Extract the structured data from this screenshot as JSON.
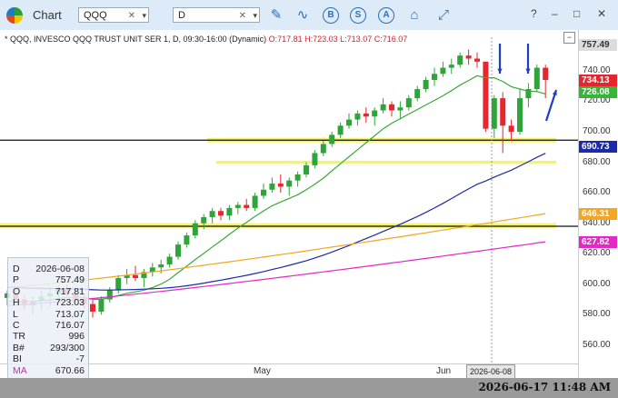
{
  "app": {
    "title": "Chart"
  },
  "toolbar": {
    "symbol": "QQQ",
    "interval": "D",
    "tools": [
      {
        "icon": "pencil-icon"
      },
      {
        "icon": "curve-tool-icon"
      },
      {
        "icon": "B",
        "type": "circle"
      },
      {
        "icon": "S",
        "type": "circle"
      },
      {
        "icon": "A",
        "type": "circle"
      },
      {
        "icon": "tag-icon"
      },
      {
        "icon": "expand-icon"
      }
    ]
  },
  "window_controls": {
    "help": "?",
    "minimize": "‒",
    "maximize": "□",
    "close": "✕"
  },
  "chart": {
    "header": "* QQQ, INVESCO QQQ TRUST UNIT SER 1, D, 09:30-16:00 (Dynamic)",
    "ohlc": "O:717.81 H:723.03 L:713.07 C:716.07",
    "price_ticks": [
      "740.00",
      "720.00",
      "700.00",
      "680.00",
      "660.00",
      "640.00",
      "620.00",
      "600.00",
      "580.00",
      "560.00"
    ],
    "price_tags": [
      {
        "label": "757.49",
        "value": 757.49,
        "bg": "#dcdcdc",
        "fg": "#333"
      },
      {
        "label": "734.13",
        "value": 734.13,
        "bg": "#e5262e",
        "fg": "#fff"
      },
      {
        "label": "726.08",
        "value": 726.08,
        "bg": "#38b43a",
        "fg": "#fff"
      },
      {
        "label": "690.73",
        "value": 690.73,
        "bg": "#1c2aa7",
        "fg": "#fff"
      },
      {
        "label": "646.31",
        "value": 646.31,
        "bg": "#f2a622",
        "fg": "#fff"
      },
      {
        "label": "627.82",
        "value": 627.82,
        "bg": "#e229c5",
        "fg": "#fff"
      }
    ],
    "date_labels": [
      "May",
      "Jun"
    ],
    "crosshair_date": "2026-06-08",
    "colors": {
      "up": "#2fa43a",
      "down": "#e8262e",
      "sma_short": "#3aa83a",
      "sma_mid": "#1c2aa7",
      "sma_long": "#f2a622",
      "sma_longest": "#e229c5",
      "zone": "#f4f25a"
    }
  },
  "data_window": {
    "rows": [
      {
        "k": "D",
        "v": "2026-06-08"
      },
      {
        "k": "P",
        "v": "757.49"
      },
      {
        "k": "O",
        "v": "717.81"
      },
      {
        "k": "H",
        "v": "723.03"
      },
      {
        "k": "L",
        "v": "713.07"
      },
      {
        "k": "C",
        "v": "716.07"
      },
      {
        "k": "TR",
        "v": "996"
      },
      {
        "k": "B#",
        "v": "293/300"
      },
      {
        "k": "BI",
        "v": "-7"
      },
      {
        "k": "MA",
        "v": "670.66"
      }
    ]
  },
  "status": {
    "clock": "2026-06-17  11:48 AM"
  },
  "chart_data": {
    "type": "candlestick",
    "ylim": [
      548,
      762
    ],
    "candles": [
      [
        591,
        596,
        586,
        594
      ],
      [
        594,
        597,
        588,
        590
      ],
      [
        590,
        593,
        583,
        586
      ],
      [
        586,
        592,
        580,
        589
      ],
      [
        589,
        596,
        583,
        592
      ],
      [
        592,
        598,
        585,
        594
      ],
      [
        594,
        599,
        589,
        597
      ],
      [
        597,
        600,
        592,
        594
      ],
      [
        594,
        596,
        588,
        590
      ],
      [
        590,
        593,
        584,
        587
      ],
      [
        587,
        590,
        578,
        582
      ],
      [
        582,
        592,
        580,
        590
      ],
      [
        590,
        598,
        588,
        596
      ],
      [
        596,
        606,
        594,
        604
      ],
      [
        604,
        610,
        600,
        606
      ],
      [
        606,
        612,
        602,
        604
      ],
      [
        604,
        610,
        598,
        608
      ],
      [
        608,
        614,
        605,
        611
      ],
      [
        611,
        616,
        607,
        613
      ],
      [
        613,
        620,
        611,
        618
      ],
      [
        618,
        628,
        616,
        626
      ],
      [
        626,
        634,
        624,
        632
      ],
      [
        632,
        642,
        630,
        640
      ],
      [
        640,
        646,
        636,
        644
      ],
      [
        644,
        650,
        640,
        648
      ],
      [
        648,
        650,
        642,
        645
      ],
      [
        645,
        652,
        642,
        650
      ],
      [
        650,
        654,
        646,
        652
      ],
      [
        652,
        656,
        648,
        650
      ],
      [
        650,
        660,
        648,
        658
      ],
      [
        658,
        666,
        656,
        662
      ],
      [
        662,
        670,
        660,
        666
      ],
      [
        666,
        672,
        660,
        664
      ],
      [
        664,
        670,
        658,
        668
      ],
      [
        668,
        674,
        664,
        672
      ],
      [
        672,
        680,
        670,
        678
      ],
      [
        678,
        688,
        676,
        686
      ],
      [
        686,
        694,
        684,
        692
      ],
      [
        692,
        700,
        690,
        698
      ],
      [
        698,
        706,
        696,
        704
      ],
      [
        704,
        712,
        702,
        708
      ],
      [
        708,
        714,
        704,
        712
      ],
      [
        712,
        716,
        706,
        710
      ],
      [
        710,
        716,
        704,
        714
      ],
      [
        714,
        722,
        712,
        718
      ],
      [
        718,
        720,
        710,
        714
      ],
      [
        714,
        720,
        708,
        716
      ],
      [
        716,
        724,
        714,
        722
      ],
      [
        722,
        730,
        720,
        728
      ],
      [
        728,
        736,
        726,
        734
      ],
      [
        734,
        742,
        730,
        738
      ],
      [
        738,
        746,
        736,
        742
      ],
      [
        742,
        748,
        738,
        744
      ],
      [
        744,
        752,
        742,
        750
      ],
      [
        750,
        754,
        744,
        748
      ],
      [
        748,
        752,
        742,
        746
      ],
      [
        746,
        726,
        700,
        702
      ],
      [
        702,
        724,
        696,
        722
      ],
      [
        722,
        726,
        686,
        704
      ],
      [
        704,
        708,
        694,
        700
      ],
      [
        700,
        728,
        698,
        722
      ],
      [
        722,
        732,
        716,
        728
      ],
      [
        728,
        744,
        726,
        742
      ],
      [
        742,
        744,
        722,
        734
      ]
    ],
    "zones": [
      {
        "from": 696,
        "to": 693
      },
      {
        "from": 681,
        "to": 679
      },
      {
        "from": 640,
        "to": 637
      }
    ],
    "hlines": [
      694.5,
      638
    ]
  }
}
